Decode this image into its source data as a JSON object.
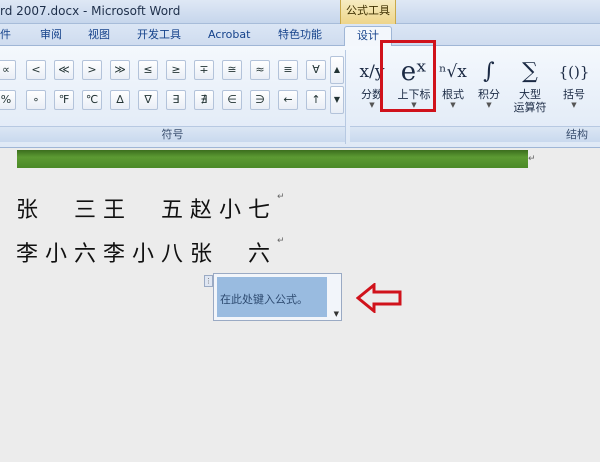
{
  "window": {
    "title": "rd 2007.docx - Microsoft Word",
    "context_tools": "公式工具"
  },
  "tabs": [
    "件",
    "审阅",
    "视图",
    "开发工具",
    "Acrobat",
    "特色功能"
  ],
  "active_tab": "设计",
  "symbols": {
    "row1": [
      "∝",
      "<",
      "≪",
      ">",
      "≫",
      "≤",
      "≥",
      "∓",
      "≅",
      "≈",
      "≡",
      "∀"
    ],
    "row2": [
      "%",
      "∘",
      "℉",
      "℃",
      "∆",
      "∇",
      "∃",
      "∄",
      "∈",
      "∋",
      "←",
      "↑"
    ],
    "group_label": "符号"
  },
  "structures": {
    "fraction": {
      "label": "分数",
      "icon": "x/y"
    },
    "script": {
      "label": "上下标",
      "icon": "eˣ"
    },
    "radical": {
      "label": "根式",
      "icon": "ⁿ√x"
    },
    "integral": {
      "label": "积分",
      "icon": "∫"
    },
    "large_operator": {
      "label1": "大型",
      "label2": "运算符",
      "icon": "∑"
    },
    "bracket": {
      "label": "括号",
      "icon": "{()}"
    },
    "group_label": "结构"
  },
  "document": {
    "line1": "张　三王　五赵小七",
    "line2": "李小六李小八张　六",
    "equation_placeholder": "在此处键入公式。"
  },
  "colors": {
    "highlight_red": "#d0121b",
    "equation_fill": "#99bbe0"
  }
}
